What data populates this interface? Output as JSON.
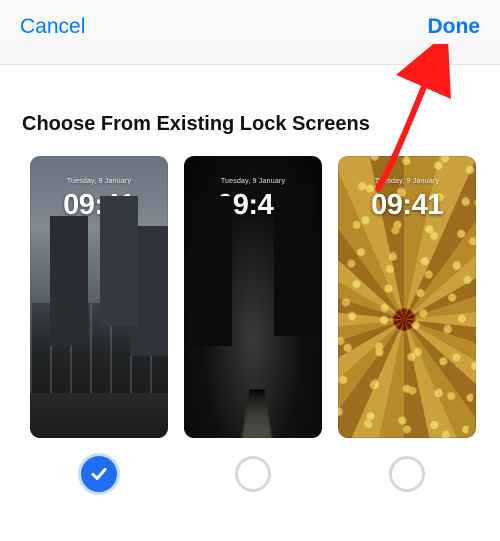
{
  "navbar": {
    "cancel_label": "Cancel",
    "done_label": "Done"
  },
  "section_title": "Choose From Existing Lock Screens",
  "lock_screens": [
    {
      "date": "Tuesday, 9 January",
      "time": "09:41",
      "selected": true,
      "name": "city-skyline"
    },
    {
      "date": "Tuesday, 9 January",
      "time": "09:41",
      "selected": false,
      "name": "dark-street"
    },
    {
      "date": "Tuesday, 9 January",
      "time": "09:41",
      "selected": false,
      "name": "emoji-spiral"
    }
  ],
  "annotation": {
    "arrow_target": "done-button",
    "color": "#ff1a1a"
  }
}
